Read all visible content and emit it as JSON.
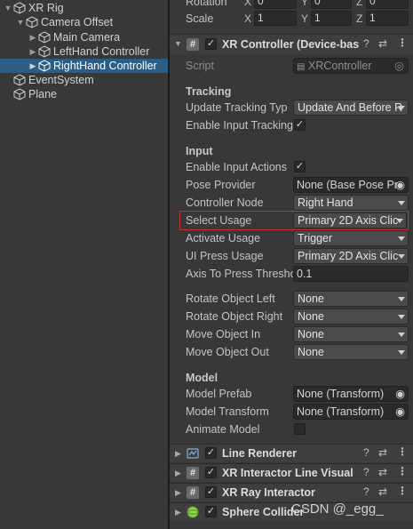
{
  "hierarchy": {
    "items": [
      {
        "label": "XR Rig",
        "expanded": true
      },
      {
        "label": "Camera Offset",
        "expanded": true
      },
      {
        "label": "Main Camera",
        "expanded": false
      },
      {
        "label": "LeftHand Controller",
        "expanded": false
      },
      {
        "label": "RightHand Controller",
        "expanded": false,
        "selected": true
      },
      {
        "label": "EventSystem"
      },
      {
        "label": "Plane"
      }
    ]
  },
  "transform": {
    "rotation_label": "Rotation",
    "scale_label": "Scale",
    "axes": [
      "X",
      "Y",
      "Z"
    ],
    "rotation": [
      "0",
      "0",
      "0"
    ],
    "scale": [
      "1",
      "1",
      "1"
    ]
  },
  "controller": {
    "title": "XR Controller (Device-bas",
    "enabled": true,
    "script_label": "Script",
    "script_value": "XRController",
    "tracking_header": "Tracking",
    "update_tracking_label": "Update Tracking Typ",
    "update_tracking_value": "Update And Before R",
    "enable_input_tracking_label": "Enable Input Tracking",
    "enable_input_tracking": true,
    "input_header": "Input",
    "enable_input_actions_label": "Enable Input Actions",
    "enable_input_actions": true,
    "pose_provider_label": "Pose Provider",
    "pose_provider_value": "None (Base Pose Pr",
    "controller_node_label": "Controller Node",
    "controller_node_value": "Right Hand",
    "select_usage_label": "Select Usage",
    "select_usage_value": "Primary 2D Axis Clic",
    "activate_usage_label": "Activate Usage",
    "activate_usage_value": "Trigger",
    "ui_press_usage_label": "UI Press Usage",
    "ui_press_usage_value": "Primary 2D Axis Clic",
    "axis_to_press_label": "Axis To Press Thresho",
    "axis_to_press_value": "0.1",
    "rotate_left_label": "Rotate Object Left",
    "rotate_left_value": "None",
    "rotate_right_label": "Rotate Object Right",
    "rotate_right_value": "None",
    "move_in_label": "Move Object In",
    "move_in_value": "None",
    "move_out_label": "Move Object Out",
    "move_out_value": "None",
    "model_header": "Model",
    "model_prefab_label": "Model Prefab",
    "model_prefab_value": "None (Transform)",
    "model_transform_label": "Model Transform",
    "model_transform_value": "None (Transform)",
    "animate_model_label": "Animate Model",
    "animate_model": false
  },
  "components": [
    {
      "title": "Line Renderer",
      "enabled": true,
      "icon": "line-renderer-icon"
    },
    {
      "title": "XR Interactor Line Visual",
      "enabled": true,
      "icon": "script-icon"
    },
    {
      "title": "XR Ray Interactor",
      "enabled": true,
      "icon": "script-icon"
    },
    {
      "title": "Sphere Collider",
      "enabled": true,
      "icon": "sphere-collider-icon"
    }
  ],
  "watermark": "CSDN @_egg_",
  "colors": {
    "selection": "#2c5d87",
    "highlight_border": "#c43232",
    "panel_bg": "#383838"
  }
}
